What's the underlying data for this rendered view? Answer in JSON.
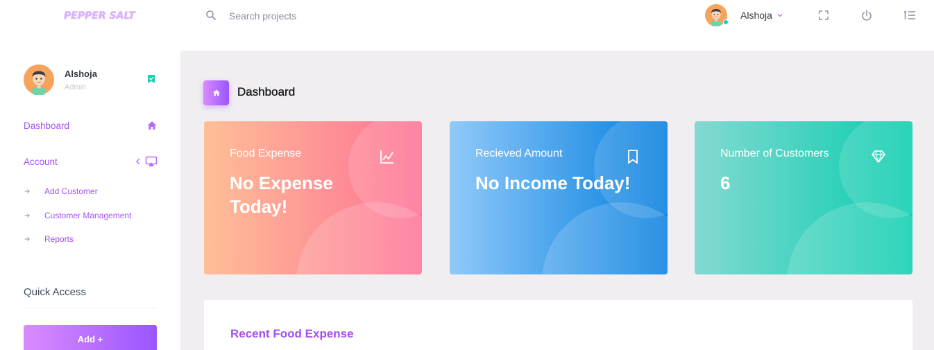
{
  "navbar": {
    "brand": "PEPPER SALT",
    "search_placeholder": "Search projects",
    "user_name": "Alshoja",
    "icons": [
      "search-icon",
      "chevron-down-icon",
      "fullscreen-icon",
      "power-icon",
      "menu-list-icon"
    ]
  },
  "sidebar": {
    "profile": {
      "name": "Alshoja",
      "role": "Admin"
    },
    "items": [
      {
        "label": "Dashboard",
        "icon": "home-icon"
      },
      {
        "label": "Account",
        "icon": "monitor-icon"
      }
    ],
    "sub_items": [
      {
        "label": "Add Customer"
      },
      {
        "label": "Customer Management"
      },
      {
        "label": "Reports"
      }
    ],
    "quick_access": {
      "title": "Quick Access",
      "button_label": "Add +"
    }
  },
  "main": {
    "page_title": "Dashboard",
    "cards": [
      {
        "label": "Food Expense",
        "value": "No Expense Today!",
        "icon": "chart-line-icon"
      },
      {
        "label": "Recieved Amount",
        "value": "No Income Today!",
        "icon": "bookmark-icon"
      },
      {
        "label": "Number of Customers",
        "value": "6",
        "icon": "diamond-icon"
      }
    ],
    "recent_title": "Recent Food Expense"
  },
  "colors": {
    "accent": "#b66dff",
    "text_accent": "#a450f0",
    "online": "#1bcfb4",
    "card_danger": [
      "#ffbf96",
      "#fe7096"
    ],
    "card_info": [
      "#90caf9",
      "#047edf"
    ],
    "card_success": [
      "#84d9d2",
      "#07cdae"
    ],
    "main_bg": "#f0eef1"
  }
}
